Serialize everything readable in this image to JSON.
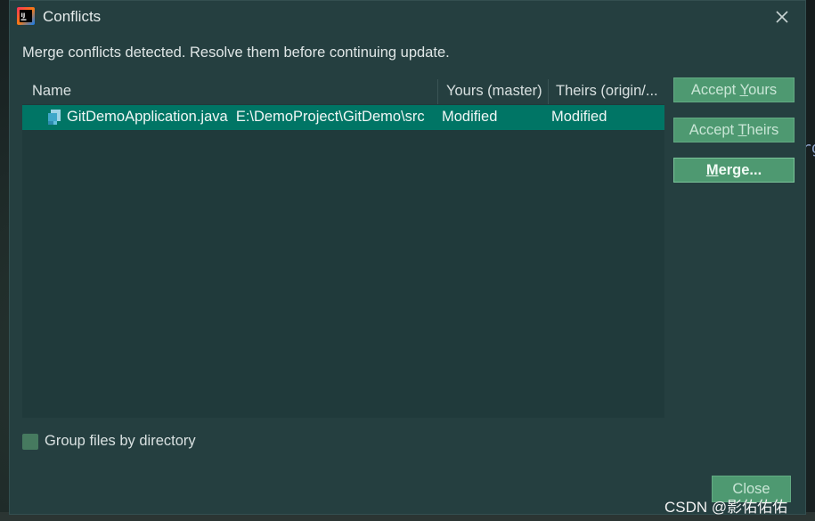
{
  "window": {
    "title": "Conflicts",
    "close_icon": "close-icon",
    "app_icon": "intellij-idea-icon"
  },
  "message": "Merge conflicts detected. Resolve them before continuing update.",
  "table": {
    "columns": [
      {
        "label": "Name"
      },
      {
        "label": "Yours (master)"
      },
      {
        "label": "Theirs (origin/..."
      }
    ],
    "rows": [
      {
        "name": "GitDemoApplication.java",
        "path": "E:\\DemoProject\\GitDemo\\src",
        "yours": "Modified",
        "theirs": "Modified",
        "icon": "java-file-icon",
        "selected": true
      }
    ]
  },
  "actions": {
    "accept_yours": {
      "pre": "Accept ",
      "mnemonic": "Y",
      "post": "ours"
    },
    "accept_theirs": {
      "pre": "Accept ",
      "mnemonic": "T",
      "post": "heirs"
    },
    "merge": {
      "pre": "",
      "mnemonic": "M",
      "post": "erge..."
    }
  },
  "group_by_directory": {
    "label": "Group files by directory",
    "checked": false
  },
  "close_button": "Close",
  "background_fragment": "rg",
  "watermark": "CSDN @影佑佑佑",
  "colors": {
    "dialog_bg": "#253f40",
    "selection": "#007565",
    "button_bg": "#4e9971"
  }
}
